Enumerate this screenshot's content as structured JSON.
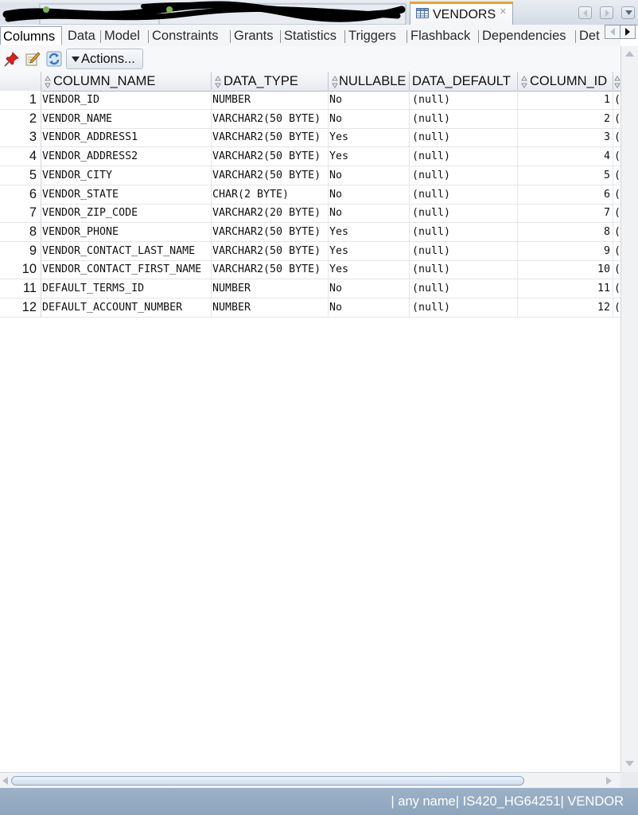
{
  "window": {
    "active_tab": "VENDORS",
    "active_tab_icon": "table-icon"
  },
  "subtabs": [
    "Columns",
    "Data",
    "Model",
    "Constraints",
    "Grants",
    "Statistics",
    "Triggers",
    "Flashback",
    "Dependencies",
    "Det"
  ],
  "subtab_active": "Columns",
  "toolbar": {
    "actions_label": "Actions..."
  },
  "grid": {
    "headers": [
      "COLUMN_NAME",
      "DATA_TYPE",
      "NULLABLE",
      "DATA_DEFAULT",
      "COLUMN_ID"
    ],
    "rows": [
      {
        "num": "1",
        "name": "VENDOR_ID",
        "type": "NUMBER",
        "nullable": "No",
        "default": "(null)",
        "id": "1"
      },
      {
        "num": "2",
        "name": "VENDOR_NAME",
        "type": "VARCHAR2(50 BYTE)",
        "nullable": "No",
        "default": "(null)",
        "id": "2"
      },
      {
        "num": "3",
        "name": "VENDOR_ADDRESS1",
        "type": "VARCHAR2(50 BYTE)",
        "nullable": "Yes",
        "default": "(null)",
        "id": "3"
      },
      {
        "num": "4",
        "name": "VENDOR_ADDRESS2",
        "type": "VARCHAR2(50 BYTE)",
        "nullable": "Yes",
        "default": "(null)",
        "id": "4"
      },
      {
        "num": "5",
        "name": "VENDOR_CITY",
        "type": "VARCHAR2(50 BYTE)",
        "nullable": "No",
        "default": "(null)",
        "id": "5"
      },
      {
        "num": "6",
        "name": "VENDOR_STATE",
        "type": "CHAR(2 BYTE)",
        "nullable": "No",
        "default": "(null)",
        "id": "6"
      },
      {
        "num": "7",
        "name": "VENDOR_ZIP_CODE",
        "type": "VARCHAR2(20 BYTE)",
        "nullable": "No",
        "default": "(null)",
        "id": "7"
      },
      {
        "num": "8",
        "name": "VENDOR_PHONE",
        "type": "VARCHAR2(50 BYTE)",
        "nullable": "Yes",
        "default": "(null)",
        "id": "8"
      },
      {
        "num": "9",
        "name": "VENDOR_CONTACT_LAST_NAME",
        "type": "VARCHAR2(50 BYTE)",
        "nullable": "Yes",
        "default": "(null)",
        "id": "9"
      },
      {
        "num": "10",
        "name": "VENDOR_CONTACT_FIRST_NAME",
        "type": "VARCHAR2(50 BYTE)",
        "nullable": "Yes",
        "default": "(null)",
        "id": "10"
      },
      {
        "num": "11",
        "name": "DEFAULT_TERMS_ID",
        "type": "NUMBER",
        "nullable": "No",
        "default": "(null)",
        "id": "11"
      },
      {
        "num": "12",
        "name": "DEFAULT_ACCOUNT_NUMBER",
        "type": "NUMBER",
        "nullable": "No",
        "default": "(null)",
        "id": "12"
      }
    ]
  },
  "statusbar": {
    "text": "| any name| IS420_HG64251| VENDOR"
  },
  "colors": {
    "statusbar_bg": "#94abc2",
    "active_tab_accent": "#e9a32b",
    "pin_red": "#d9231d",
    "refresh_blue": "#2f79c9"
  }
}
